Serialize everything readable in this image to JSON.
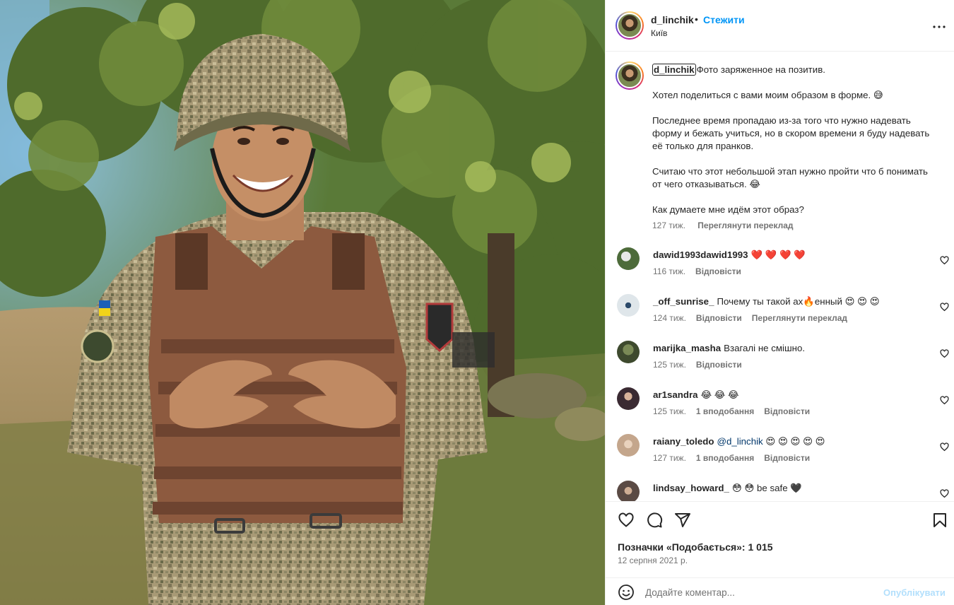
{
  "post": {
    "image_alt": "",
    "header": {
      "username": "d_linchik",
      "separator": "•",
      "follow_label": "Стежити",
      "location": "Київ",
      "more_icon": "more-horizontal-icon"
    },
    "caption": {
      "username": "d_linchik",
      "paragraphs": [
        "Фото заряженное на позитив.",
        "Хотел поделиться с вами моим образом в форме. 😅",
        "Последнее время пропадаю из-за того что нужно надевать форму и бежать учиться, но в скором времени я буду надевать её только для пранков.",
        "Считаю что этот небольшой этап нужно пройти что б понимать от чего отказываться. 😂",
        "Как думаете мне идём этот образ?"
      ],
      "time": "127 тиж.",
      "translate_label": "Переглянути переклад"
    },
    "comments": [
      {
        "username": "dawid1993dawid1993",
        "text": "❤️ ❤️ ❤️ ❤️",
        "time": "116 тиж.",
        "likes": "",
        "reply": "Відповісти",
        "translate": "",
        "avatar_color": "#4d6b3a"
      },
      {
        "username": "_off_sunrise_",
        "text": "Почему ты такой ах🔥енный 😍 😍 😍",
        "time": "124 тиж.",
        "likes": "",
        "reply": "Відповісти",
        "translate": "Переглянути переклад",
        "avatar_color": "#dfe6ea"
      },
      {
        "username": "marijka_masha",
        "text": "Взагалі не смішно.",
        "time": "125 тиж.",
        "likes": "",
        "reply": "Відповісти",
        "translate": "",
        "avatar_color": "#3e4a2e"
      },
      {
        "username": "ar1sandra",
        "text": "😂 😂 😂",
        "time": "125 тиж.",
        "likes": "1 вподобання",
        "reply": "Відповісти",
        "translate": "",
        "avatar_color": "#3a2a32"
      },
      {
        "username": "raiany_toledo",
        "mention": "@d_linchik",
        "text": "😍 😍 😍 😍 😍",
        "time": "127 тиж.",
        "likes": "1 вподобання",
        "reply": "Відповісти",
        "translate": "",
        "avatar_color": "#c4a68c"
      },
      {
        "username": "lindsay_howard_",
        "text": "😳 😳  be safe 🖤",
        "time": "",
        "likes": "",
        "reply": "",
        "translate": "",
        "avatar_color": "#5a4a44"
      }
    ],
    "actions": {
      "like_icon": "heart-icon",
      "comment_icon": "comment-icon",
      "share_icon": "send-icon",
      "save_icon": "bookmark-icon",
      "likes_text": "Позначки «Подобається»: 1 015",
      "date": "12 серпня 2021 р."
    },
    "add_comment": {
      "emoji_icon": "emoji-icon",
      "placeholder": "Додайте коментар...",
      "post_label": "Опублікувати"
    }
  },
  "colors": {
    "link_blue": "#0095f6",
    "post_disabled": "#b2dffc",
    "secondary_text": "#737373",
    "heart_red": "#ed4956"
  }
}
